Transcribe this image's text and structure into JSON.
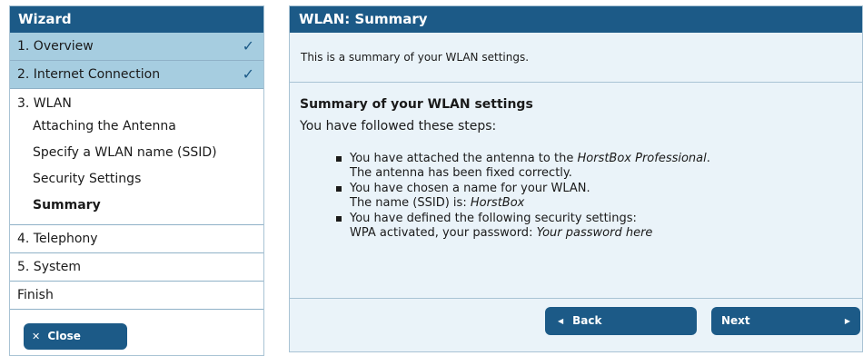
{
  "sidebar": {
    "title": "Wizard",
    "steps": [
      {
        "label": "1. Overview",
        "done": true
      },
      {
        "label": "2. Internet Connection",
        "done": true
      }
    ],
    "wlan": {
      "title": "3. WLAN",
      "substeps": [
        {
          "label": "Attaching the Antenna"
        },
        {
          "label": "Specify a WLAN name (SSID)"
        },
        {
          "label": "Security Settings"
        },
        {
          "label": "Summary",
          "active": true
        }
      ]
    },
    "steps_after": [
      {
        "label": "4. Telephony"
      },
      {
        "label": "5. System"
      },
      {
        "label": "Finish"
      }
    ],
    "close_label": "Close",
    "check_glyph": "✓"
  },
  "panel": {
    "title": "WLAN: Summary",
    "intro": "This is a summary of your WLAN settings.",
    "heading": "Summary of your WLAN settings",
    "subtext": "You have followed these steps:",
    "bullets": [
      {
        "line1_prefix": "You have attached the antenna to the ",
        "line1_em": "HorstBox Professional",
        "line1_suffix": ".",
        "line2_prefix": "The antenna has been fixed correctly.",
        "line2_em": ""
      },
      {
        "line1_prefix": "You have chosen a name for your WLAN.",
        "line1_em": "",
        "line1_suffix": "",
        "line2_prefix": "The name (SSID) is: ",
        "line2_em": "HorstBox"
      },
      {
        "line1_prefix": "You have defined the following security settings:",
        "line1_em": "",
        "line1_suffix": "",
        "line2_prefix": "WPA activated, your password: ",
        "line2_em": "Your password here"
      }
    ],
    "back_label": "Back",
    "next_label": "Next"
  },
  "colors": {
    "header_blue": "#1c5a87",
    "done_step_bg": "#a6cde0",
    "panel_bg": "#eaf3f9"
  }
}
